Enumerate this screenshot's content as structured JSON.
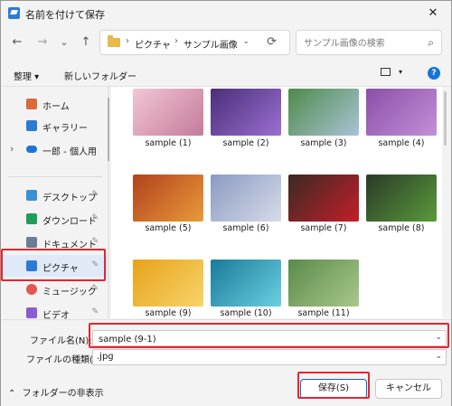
{
  "window": {
    "title": "名前を付けて保存",
    "close_icon": "close-icon"
  },
  "nav": {
    "back": "←",
    "forward": "→",
    "recent": "⌄",
    "up": "↑",
    "breadcrumb": [
      "ピクチャ",
      "サンプル画像"
    ],
    "separator": "›",
    "address_dropdown": "⌄",
    "refresh": "⟳",
    "search_placeholder": "サンプル画像の検索"
  },
  "toolbar": {
    "organize": "整理 ▾",
    "new_folder": "新しいフォルダー",
    "help": "?"
  },
  "sidebar": {
    "items": [
      {
        "label": "ホーム",
        "icon": "home-icon",
        "color": "#d96a3a"
      },
      {
        "label": "ギャラリー",
        "icon": "gallery-icon",
        "color": "#2b7bd6"
      },
      {
        "label": "一郎 - 個人用",
        "icon": "onedrive-icon",
        "color": "#1a73d9"
      },
      {
        "label": "デスクトップ",
        "icon": "desktop-icon",
        "color": "#3a8fd8"
      },
      {
        "label": "ダウンロード",
        "icon": "download-icon",
        "color": "#1f9e5a"
      },
      {
        "label": "ドキュメント",
        "icon": "documents-icon",
        "color": "#6b7c93"
      },
      {
        "label": "ピクチャ",
        "icon": "pictures-icon",
        "color": "#2b7bd6"
      },
      {
        "label": "ミュージック",
        "icon": "music-icon",
        "color": "#e0574f"
      },
      {
        "label": "ビデオ",
        "icon": "video-icon",
        "color": "#8a5cd6"
      }
    ],
    "pin": "📌",
    "expand": "›"
  },
  "files": [
    {
      "name": "sample (1)",
      "colors": [
        "#f2c6d6",
        "#c47a9a"
      ]
    },
    {
      "name": "sample (2)",
      "colors": [
        "#4a2f7a",
        "#9b6fd0"
      ]
    },
    {
      "name": "sample (3)",
      "colors": [
        "#4f8a4a",
        "#a9c3d6"
      ]
    },
    {
      "name": "sample (4)",
      "colors": [
        "#8a4fa8",
        "#c48fd8"
      ]
    },
    {
      "name": "sample (5)",
      "colors": [
        "#b2421e",
        "#e89a3a"
      ]
    },
    {
      "name": "sample (6)",
      "colors": [
        "#8a9ac2",
        "#d6dbe8"
      ]
    },
    {
      "name": "sample (7)",
      "colors": [
        "#3a2a24",
        "#c21f2a"
      ]
    },
    {
      "name": "sample (8)",
      "colors": [
        "#2a3a2a",
        "#5a9a3a"
      ]
    },
    {
      "name": "sample (9)",
      "colors": [
        "#e8a21a",
        "#f6d46a"
      ]
    },
    {
      "name": "sample (10)",
      "colors": [
        "#1a7a9a",
        "#6ad0e0"
      ]
    },
    {
      "name": "sample (11)",
      "colors": [
        "#5a8a4a",
        "#a8c88a"
      ]
    }
  ],
  "form": {
    "filename_label": "ファイル名(N):",
    "filename_value": "sample (9-1)",
    "filetype_label": "ファイルの種類(T):",
    "filetype_value": ".jpg",
    "dropdown": "⌄"
  },
  "footer": {
    "hide_folders": "フォルダーの非表示",
    "hide_icon": "⌃",
    "save": "保存(S)",
    "cancel": "キャンセル"
  },
  "highlight_color": "#e8242e"
}
